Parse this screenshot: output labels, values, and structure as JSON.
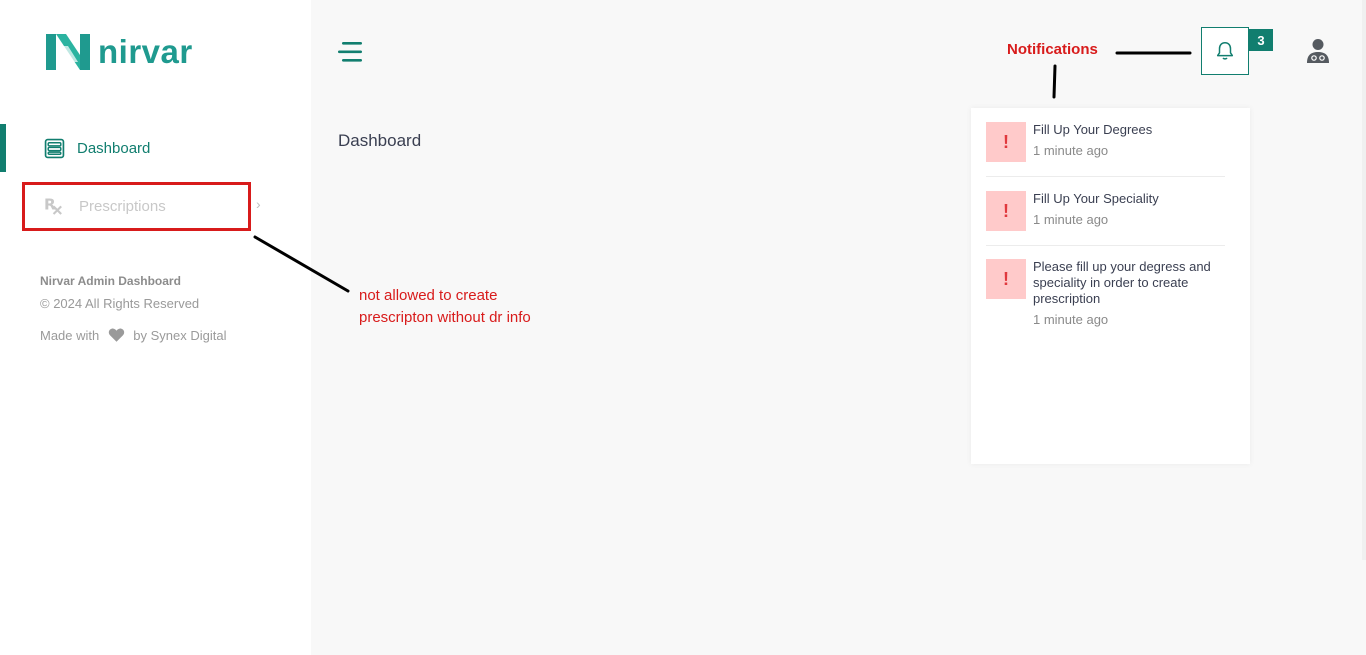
{
  "brand": {
    "name": "nirvar",
    "color": "#1f9a8f"
  },
  "sidebar": {
    "items": [
      {
        "label": "Dashboard",
        "icon": "dashboard-icon",
        "active": true
      },
      {
        "label": "Prescriptions",
        "icon": "rx-icon",
        "disabled": true
      }
    ],
    "footer": {
      "title": "Nirvar Admin Dashboard",
      "copyright": "© 2024 All Rights Reserved",
      "made_with": "Made with",
      "made_by": "by Synex Digital"
    }
  },
  "main": {
    "page_title": "Dashboard"
  },
  "header": {
    "notifications_annotation": "Notifications",
    "notification_count": "3"
  },
  "annotations": {
    "prescription_note_line1": "not allowed to create",
    "prescription_note_line2": "prescripton without dr info"
  },
  "notifications": [
    {
      "text": "Fill Up Your Degrees",
      "time": "1 minute ago"
    },
    {
      "text": "Fill Up Your Speciality",
      "time": "1 minute ago"
    },
    {
      "text": "Please fill up your degress and speciality in order to create prescription",
      "time": "1 minute ago"
    }
  ],
  "colors": {
    "accent": "#117e6f",
    "annotation_red": "#d81b1b",
    "warn_bg": "#ffcaca"
  }
}
